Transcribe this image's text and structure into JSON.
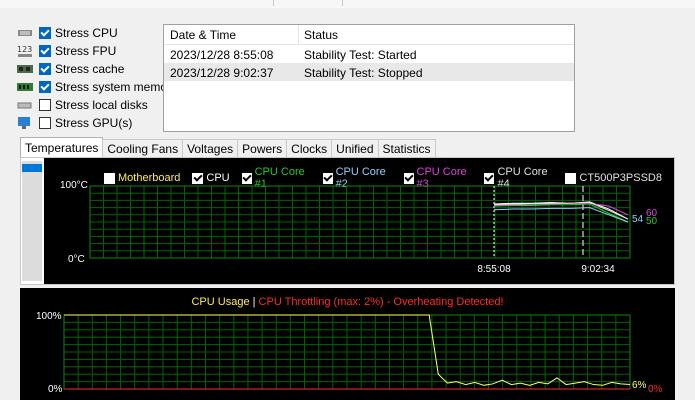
{
  "options": [
    {
      "label": "Stress CPU",
      "checked": true,
      "icon": "cpu-chip-icon"
    },
    {
      "label": "Stress FPU",
      "checked": true,
      "icon": "fpu-123-icon"
    },
    {
      "label": "Stress cache",
      "checked": true,
      "icon": "memory-chip-icon"
    },
    {
      "label": "Stress system memory",
      "checked": true,
      "icon": "ram-module-icon"
    },
    {
      "label": "Stress local disks",
      "checked": false,
      "icon": "disk-drive-icon"
    },
    {
      "label": "Stress GPU(s)",
      "checked": false,
      "icon": "gpu-monitor-icon"
    }
  ],
  "log": {
    "headers": [
      "Date & Time",
      "Status"
    ],
    "rows": [
      {
        "time": "2023/12/28 8:55:08",
        "status": "Stability Test: Started"
      },
      {
        "time": "2023/12/28 9:02:37",
        "status": "Stability Test: Stopped"
      }
    ]
  },
  "tabs": [
    "Temperatures",
    "Cooling Fans",
    "Voltages",
    "Powers",
    "Clocks",
    "Unified",
    "Statistics"
  ],
  "active_tab": "Temperatures",
  "colors": {
    "cpu": "#ffffff",
    "core1": "#22cc22",
    "core2": "#8fd0ff",
    "core3": "#e040e0",
    "core4": "#e0e0e0",
    "motherboard": "#ffee55",
    "grid": "#006400",
    "throttle": "#ff2a2a",
    "usage": "#ffff66"
  },
  "temp_chart": {
    "legend": [
      {
        "label": "Motherboard",
        "checked": false,
        "color": "#ffee55"
      },
      {
        "label": "CPU",
        "checked": true,
        "color": "#ffffff"
      },
      {
        "label": "CPU Core #1",
        "checked": true,
        "color": "#22cc22"
      },
      {
        "label": "CPU Core #2",
        "checked": true,
        "color": "#8fd0ff"
      },
      {
        "label": "CPU Core #3",
        "checked": true,
        "color": "#e040e0"
      },
      {
        "label": "CPU Core #4",
        "checked": true,
        "color": "#e0e0e0"
      },
      {
        "label": "CT500P3PSSD8",
        "checked": false,
        "color": "#e0e0e0"
      }
    ],
    "y_top_label": "100",
    "y_bottom_label": "0",
    "unit": "°C",
    "x_labels": [
      "8:55:08",
      "9:02:34"
    ],
    "end_labels": [
      "60",
      "54",
      "50"
    ]
  },
  "usage_chart": {
    "title_usage": "CPU Usage",
    "title_sep": "|",
    "title_throttle": "CPU Throttling (max: 2%) - Overheating Detected!",
    "y_top_label": "100%",
    "y_bottom_label": "0%",
    "end_usage_label": "6%",
    "end_throttle_label": "0%"
  },
  "chart_data": [
    {
      "type": "line",
      "title": "",
      "ylabel": "°C",
      "ylim": [
        0,
        100
      ],
      "series": [
        {
          "name": "CPU",
          "x": [
            0,
            1,
            2,
            3,
            4,
            5,
            6,
            7
          ],
          "values": [
            75,
            76,
            76,
            77,
            76,
            78,
            68,
            54
          ]
        },
        {
          "name": "CPU Core #1",
          "x": [
            0,
            1,
            2,
            3,
            4,
            5,
            6,
            7
          ],
          "values": [
            72,
            73,
            73,
            74,
            74,
            75,
            62,
            50
          ]
        },
        {
          "name": "CPU Core #2",
          "x": [
            0,
            1,
            2,
            3,
            4,
            5,
            6,
            7
          ],
          "values": [
            67,
            68,
            68,
            69,
            69,
            70,
            60,
            50
          ]
        },
        {
          "name": "CPU Core #3",
          "x": [
            0,
            1,
            2,
            3,
            4,
            5,
            6,
            7
          ],
          "values": [
            73,
            74,
            75,
            75,
            76,
            76,
            72,
            60
          ]
        },
        {
          "name": "CPU Core #4",
          "x": [
            0,
            1,
            2,
            3,
            4,
            5,
            6,
            7
          ],
          "values": [
            74,
            75,
            75,
            76,
            76,
            77,
            66,
            54
          ]
        }
      ]
    },
    {
      "type": "line",
      "title": "CPU Usage",
      "ylim": [
        0,
        100
      ],
      "series": [
        {
          "name": "CPU Usage",
          "values": [
            100,
            100,
            100,
            100,
            100,
            100,
            100,
            100,
            100,
            100,
            100,
            100,
            100,
            100,
            100,
            100,
            100,
            100,
            100,
            100,
            100,
            100,
            100,
            100,
            100,
            100,
            100,
            100,
            100,
            100,
            100,
            100,
            100,
            100,
            100,
            100,
            100,
            100,
            100,
            100,
            100,
            20,
            8,
            10,
            6,
            9,
            5,
            7,
            12,
            6,
            8,
            5,
            9,
            7,
            15,
            6,
            8,
            10,
            6,
            5,
            9,
            7,
            6
          ]
        },
        {
          "name": "CPU Throttling",
          "values": [
            0,
            0,
            0,
            0,
            0,
            0,
            0,
            0,
            0,
            0,
            0,
            0,
            0,
            0,
            0,
            0,
            0,
            0,
            0,
            0,
            0,
            0,
            0,
            0,
            0,
            0,
            0,
            0,
            0,
            0,
            0,
            0,
            0,
            0,
            0,
            0,
            0,
            0,
            0,
            0,
            0,
            0,
            0,
            0,
            0,
            0,
            0,
            0,
            0,
            0,
            0,
            0,
            0,
            0,
            0,
            0,
            0,
            0,
            0,
            0,
            0,
            0,
            0
          ]
        }
      ]
    }
  ]
}
